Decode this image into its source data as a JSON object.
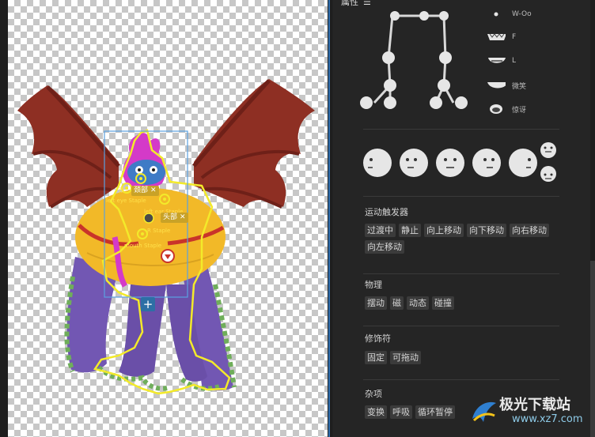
{
  "canvas": {
    "staples": {
      "left_eye": "left eye Staple",
      "left_ear": "left ear Staple",
      "mouth": "mouth Staple",
      "right_eye": "R Staple",
      "brow": "颈"
    },
    "tags": {
      "head_tag": "头部",
      "neck_tag": "颈部"
    },
    "add_button_label": "+"
  },
  "panel": {
    "title": "属性",
    "menu_icon": "hamburger-icon",
    "mouths": [
      {
        "label": "W-Oo"
      },
      {
        "label": "F"
      },
      {
        "label": "L"
      },
      {
        "label": "微笑"
      },
      {
        "label": "惊讶"
      }
    ],
    "sections": {
      "motion_triggers": {
        "title": "运动触发器",
        "items": [
          "过渡中",
          "静止",
          "向上移动",
          "向下移动",
          "向右移动",
          "向左移动"
        ]
      },
      "physics": {
        "title": "物理",
        "items": [
          "摆动",
          "磁",
          "动态",
          "碰撞"
        ]
      },
      "modifiers": {
        "title": "修饰符",
        "items": [
          "固定",
          "可拖动"
        ]
      },
      "misc": {
        "title": "杂项",
        "items": [
          "变换",
          "呼吸",
          "循环暂停"
        ]
      }
    }
  },
  "watermark": {
    "brand": "极光下载站",
    "url": "www.xz7.com"
  }
}
